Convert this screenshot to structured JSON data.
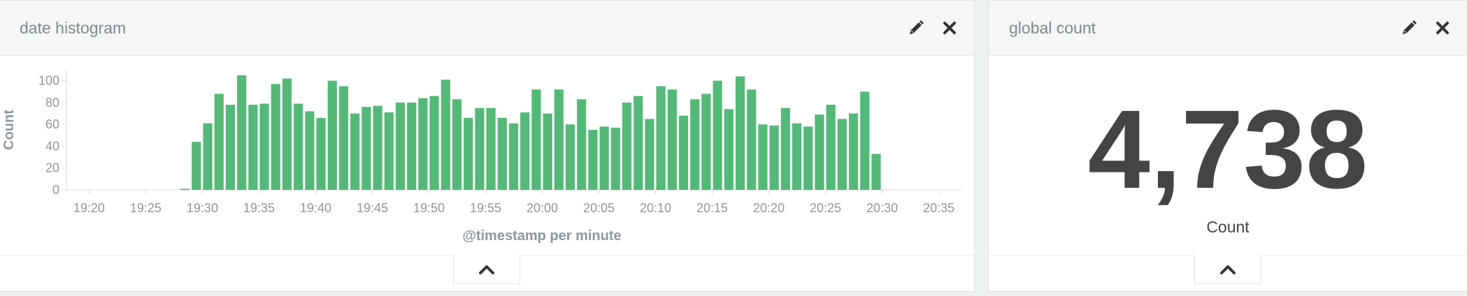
{
  "histogram_panel": {
    "title": "date histogram",
    "edit_icon": "pencil-icon",
    "close_icon": "close-icon",
    "toggle_icon": "chevron-up-icon"
  },
  "count_panel": {
    "title": "global count",
    "edit_icon": "pencil-icon",
    "close_icon": "close-icon",
    "toggle_icon": "chevron-up-icon",
    "value": "4,738",
    "label": "Count"
  },
  "colors": {
    "bar": "#54b978",
    "axis_text": "#8e979f",
    "axis_title": "#8e979f",
    "metric_text": "#444444"
  },
  "chart_data": {
    "type": "bar",
    "xlabel": "@timestamp per minute",
    "ylabel": "Count",
    "ylim": [
      0,
      110
    ],
    "yticks": [
      0,
      20,
      40,
      60,
      80,
      100
    ],
    "xlim": [
      "19:18",
      "20:37"
    ],
    "x_tick_labels": [
      "19:20",
      "19:25",
      "19:30",
      "19:35",
      "19:40",
      "19:45",
      "19:50",
      "19:55",
      "20:00",
      "20:05",
      "20:10",
      "20:15",
      "20:20",
      "20:25",
      "20:30",
      "20:35"
    ],
    "bin": "1 minute",
    "x": [
      "19:28",
      "19:29",
      "19:30",
      "19:31",
      "19:32",
      "19:33",
      "19:34",
      "19:35",
      "19:36",
      "19:37",
      "19:38",
      "19:39",
      "19:40",
      "19:41",
      "19:42",
      "19:43",
      "19:44",
      "19:45",
      "19:46",
      "19:47",
      "19:48",
      "19:49",
      "19:50",
      "19:51",
      "19:52",
      "19:53",
      "19:54",
      "19:55",
      "19:56",
      "19:57",
      "19:58",
      "19:59",
      "20:00",
      "20:01",
      "20:02",
      "20:03",
      "20:04",
      "20:05",
      "20:06",
      "20:07",
      "20:08",
      "20:09",
      "20:10",
      "20:11",
      "20:12",
      "20:13",
      "20:14",
      "20:15",
      "20:16",
      "20:17",
      "20:18",
      "20:19",
      "20:20",
      "20:21",
      "20:22",
      "20:23",
      "20:24",
      "20:25",
      "20:26",
      "20:27",
      "20:28",
      "20:29"
    ],
    "values": [
      1,
      44,
      61,
      88,
      78,
      105,
      78,
      79,
      97,
      102,
      79,
      72,
      66,
      100,
      95,
      70,
      76,
      77,
      71,
      80,
      80,
      84,
      86,
      101,
      83,
      66,
      75,
      75,
      66,
      61,
      71,
      92,
      70,
      92,
      60,
      83,
      55,
      58,
      57,
      80,
      86,
      65,
      95,
      92,
      68,
      83,
      88,
      100,
      74,
      104,
      92,
      60,
      59,
      75,
      61,
      58,
      69,
      78,
      65,
      70,
      90,
      33
    ]
  }
}
